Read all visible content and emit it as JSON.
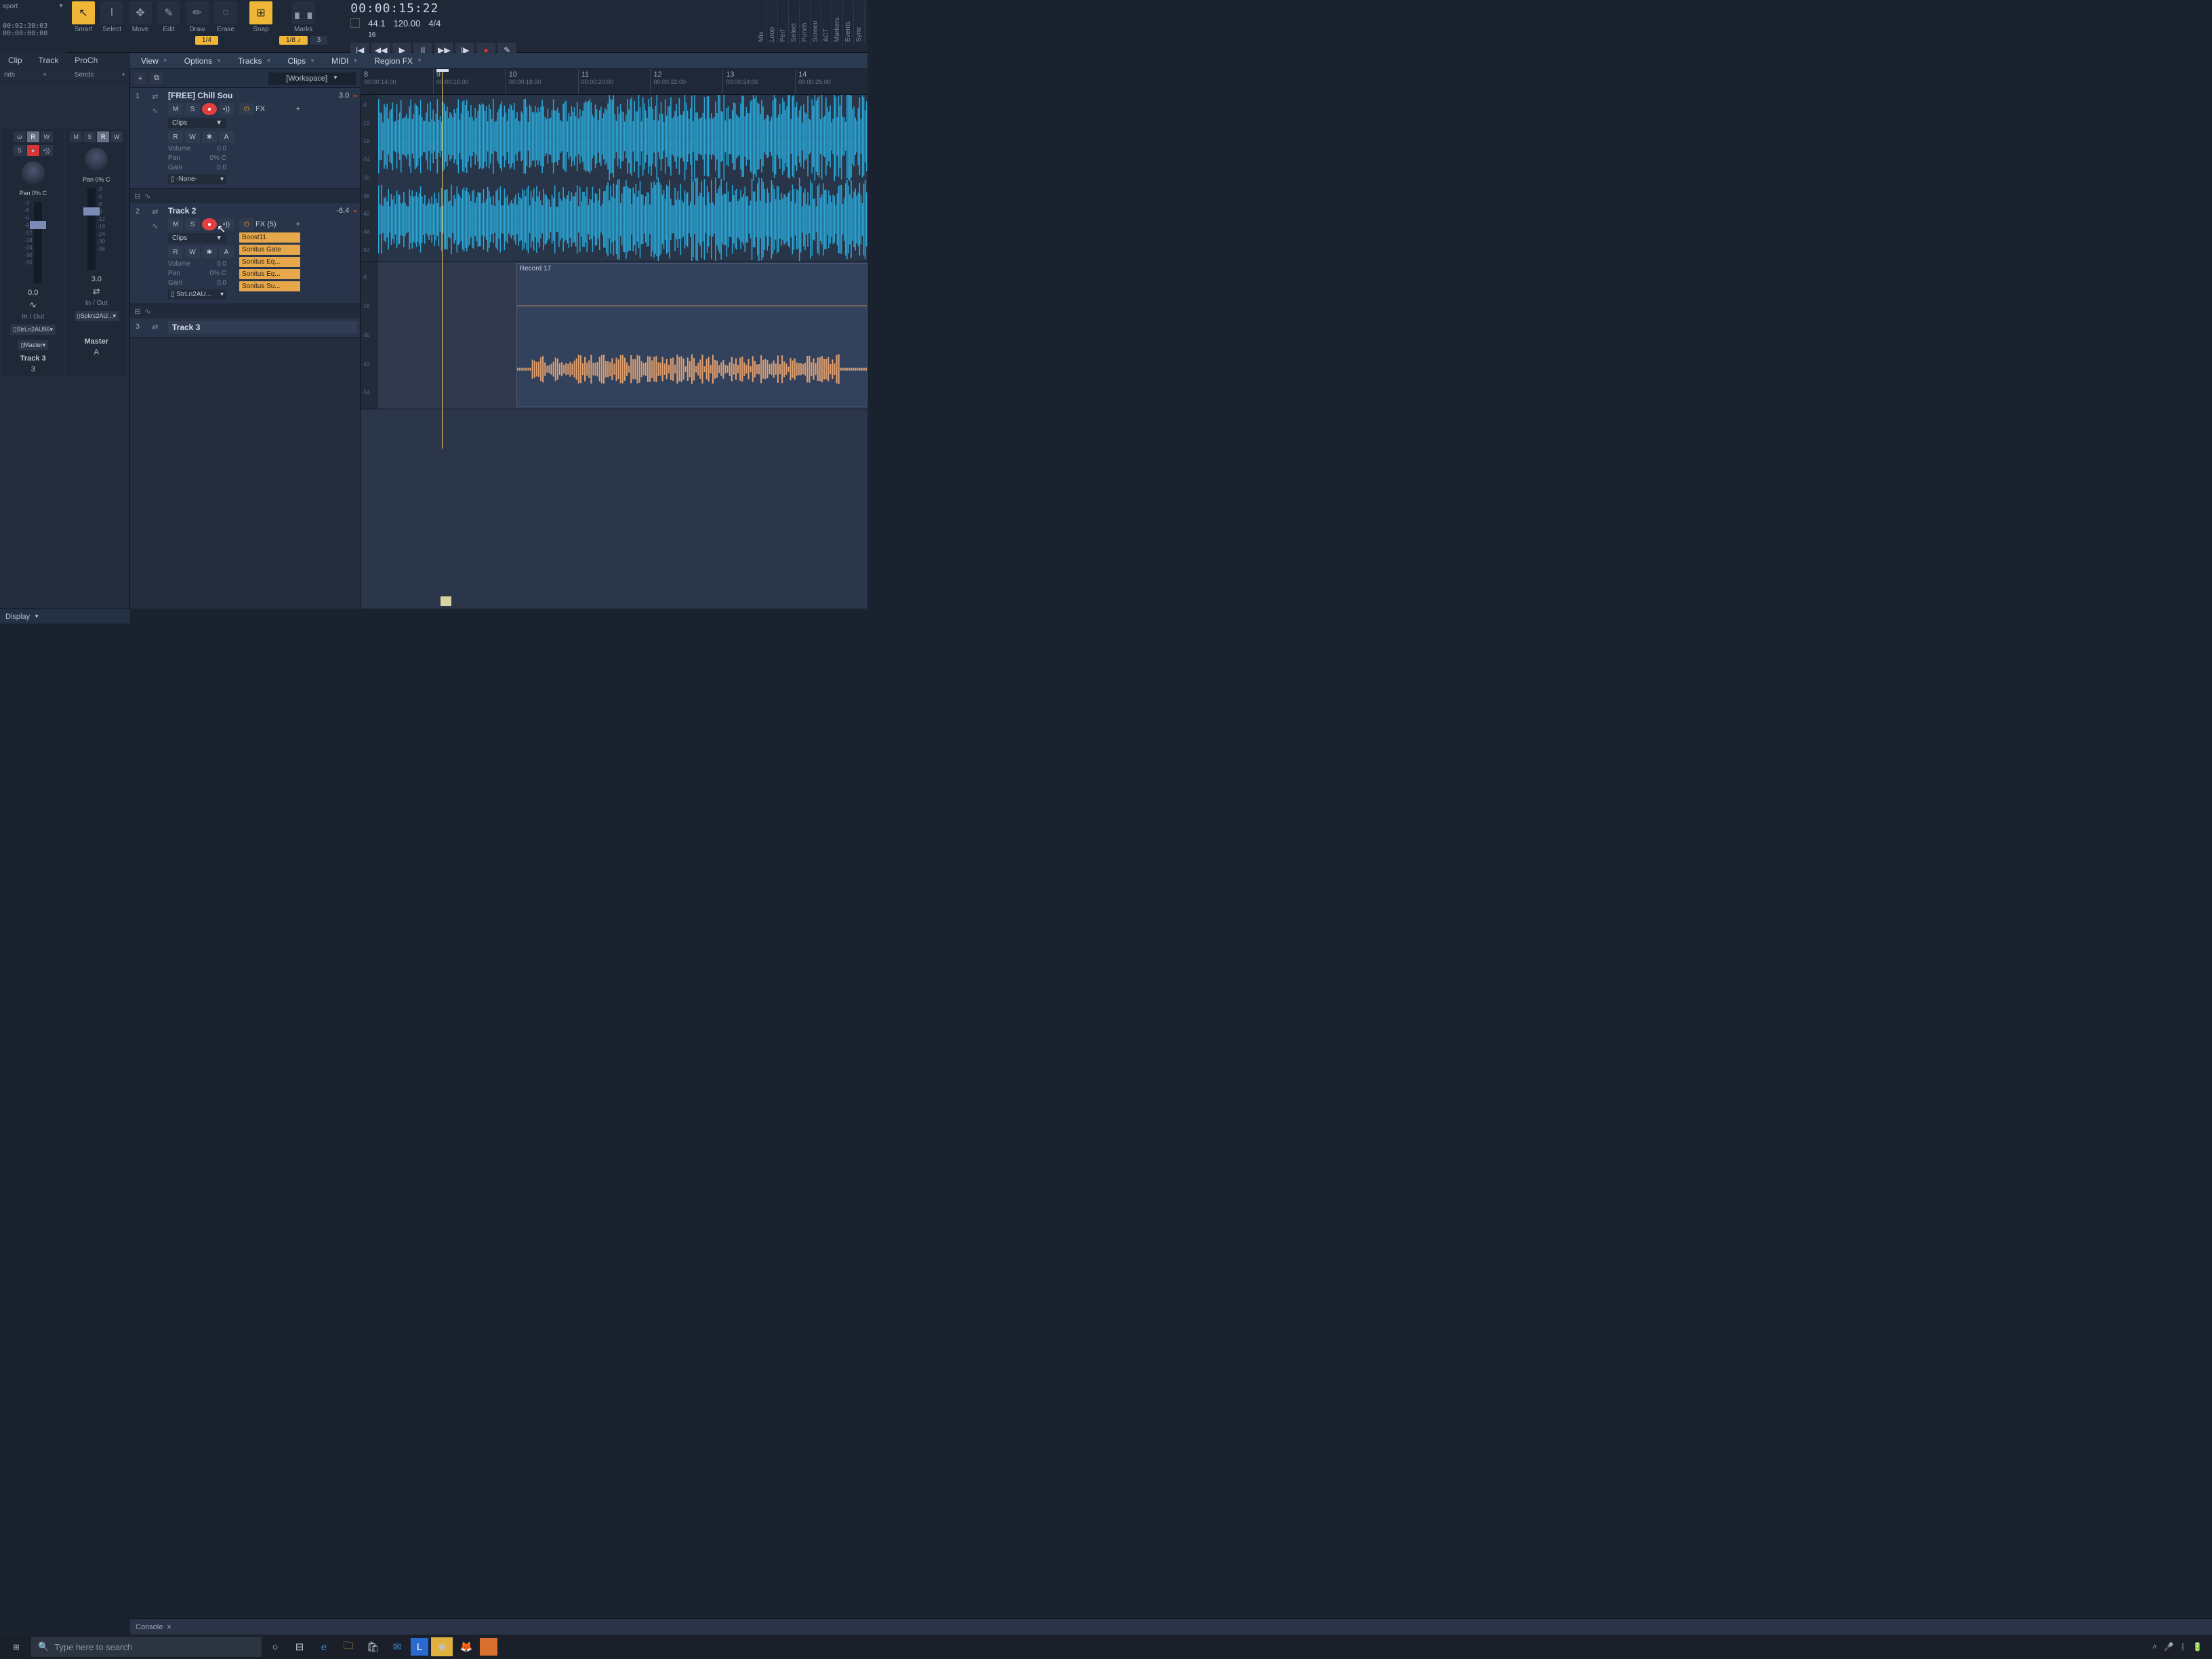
{
  "export": {
    "label": "xport",
    "time1": "00:02:30:03",
    "time2": "00:00:00:00"
  },
  "toolbar": {
    "tools": [
      {
        "icon": "↖",
        "label": "Smart",
        "active": true
      },
      {
        "icon": "I",
        "label": "Select"
      },
      {
        "icon": "✥",
        "label": "Move"
      },
      {
        "icon": "✎",
        "label": "Edit"
      },
      {
        "icon": "✏",
        "label": "Draw"
      },
      {
        "icon": "◌",
        "label": "Erase"
      }
    ],
    "snap": {
      "icon": "⊞",
      "label": "Snap",
      "active": true
    },
    "marks_label": "Marks",
    "snap_vals": [
      "1/4",
      "1/8 ♪",
      "3"
    ],
    "tc": "00:00:15:22",
    "sr": "44.1",
    "bits": "16",
    "tempo": "120.00",
    "sig": "4/4",
    "transport": [
      "|◀",
      "◀◀",
      "▶",
      "||",
      "▶▶",
      "|▶",
      "●",
      "✎"
    ],
    "vtabs": [
      "Mix",
      "Loop",
      "Perf",
      "Select",
      "Punch",
      "Screen",
      "ACT",
      "Markers",
      "Events",
      "Sync"
    ]
  },
  "left_tabs": [
    "Clip",
    "Track",
    "ProCh"
  ],
  "menus": [
    "View",
    "Options",
    "Tracks",
    "Clips",
    "MIDI",
    "Region FX"
  ],
  "inspector": {
    "heads": [
      "nds",
      "Sends"
    ],
    "pan": "Pan",
    "pan_val": "0% C",
    "val_left": "0.0",
    "val_right": "3.0",
    "io": "In / Out",
    "route1_l": "StrLn2AU96",
    "route2_l": "Master",
    "route1_r": "Spkrs2AU...",
    "name_l": "Track 3",
    "sub_l": "3",
    "name_r": "Master",
    "sub_r": "A",
    "ticks": [
      "-3",
      "-6",
      "-6",
      "-9",
      "-12",
      "-18",
      "-24",
      "-30",
      "-36"
    ]
  },
  "panel": {
    "workspace": "[Workspace]"
  },
  "ruler": [
    {
      "bar": "8",
      "tc": "00:00:14:00"
    },
    {
      "bar": "9",
      "tc": "00:00:16:00"
    },
    {
      "bar": "10",
      "tc": "00:00:18:00"
    },
    {
      "bar": "11",
      "tc": "00:00:20:00"
    },
    {
      "bar": "12",
      "tc": "00:00:22:00"
    },
    {
      "bar": "13",
      "tc": "00:00:24:00"
    },
    {
      "bar": "14",
      "tc": "00:00:26:00"
    }
  ],
  "tracks": [
    {
      "num": "1",
      "name": "[FREE] Chill Sou",
      "level": "3.0",
      "fx_label": "FX",
      "clips": "Clips",
      "rwbtns": [
        "R",
        "W",
        "✱",
        "A"
      ],
      "params": [
        [
          "Volume",
          "0.0"
        ],
        [
          "Pan",
          "0% C"
        ],
        [
          "Gain",
          "0.0"
        ]
      ],
      "output": "-None-",
      "db": [
        "-6",
        "-12",
        "-18",
        "-24",
        "-30",
        "-36",
        "-42",
        "-48",
        "-54"
      ]
    },
    {
      "num": "2",
      "name": "Track 2",
      "level": "-6.4",
      "fx_label": "FX (5)",
      "clips": "Clips",
      "rwbtns": [
        "R",
        "W",
        "✱",
        "A"
      ],
      "params": [
        [
          "Volume",
          "0.0"
        ],
        [
          "Pan",
          "0% C"
        ],
        [
          "Gain",
          "0.0"
        ]
      ],
      "output": "StrLn2AU...",
      "fx_items": [
        "Boost11",
        "Sonitus Gate",
        "Sonitus Eq...",
        "Sonitus Eq...",
        "Sonitus Su..."
      ],
      "clip_name": "Record 17"
    },
    {
      "num": "3",
      "name": "Track 3"
    }
  ],
  "display_tab": "Display",
  "console_tab": "Console",
  "taskbar": {
    "search_placeholder": "Type here to search"
  }
}
